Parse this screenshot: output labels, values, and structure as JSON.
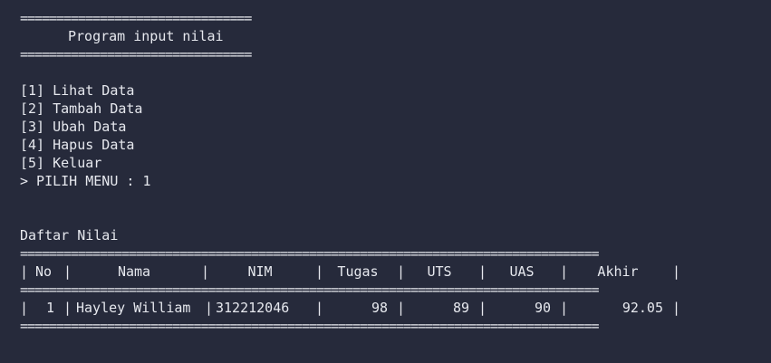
{
  "header": {
    "rule": "================================",
    "title": "Program input nilai"
  },
  "menu": {
    "items": [
      {
        "label": "[1] Lihat Data"
      },
      {
        "label": "[2] Tambah Data"
      },
      {
        "label": "[3] Ubah Data"
      },
      {
        "label": "[4] Hapus Data"
      },
      {
        "label": "[5] Keluar"
      }
    ],
    "prompt": "> PILIH MENU : 1"
  },
  "table": {
    "caption": "Daftar Nilai",
    "rule": "================================================================================",
    "bar": "|",
    "columns": [
      "No",
      "Nama",
      "NIM",
      "Tugas",
      "UTS",
      "UAS",
      "Akhir"
    ],
    "rows": [
      {
        "no": "1",
        "nama": "Hayley William",
        "nim": "312212046",
        "tugas": "98",
        "uts": "89",
        "uas": "90",
        "akhir": "92.05"
      }
    ]
  }
}
